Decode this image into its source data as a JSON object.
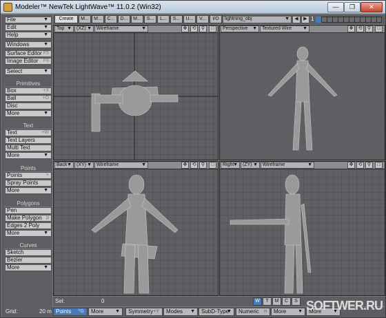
{
  "window": {
    "title": "Modeler™ NewTek LightWave™ 11.0.2 (Win32)",
    "controls": [
      "—",
      "❐",
      "✕"
    ]
  },
  "menu": {
    "file": "File",
    "edit": "Edit",
    "help": "Help",
    "windows": "Windows",
    "surface_editor": "Surface Editor",
    "surface_editor_key": "F5",
    "image_editor": "Image Editor",
    "image_editor_key": "F6",
    "select": "Select"
  },
  "groups": {
    "primitives": {
      "title": "Primitives",
      "items": [
        {
          "label": "Box",
          "key": "+X"
        },
        {
          "label": "Ball",
          "key": "+O"
        },
        {
          "label": "Disc",
          "key": ""
        },
        {
          "label": "More",
          "key": ""
        }
      ]
    },
    "text": {
      "title": "Text",
      "items": [
        {
          "label": "Text",
          "key": "+W"
        },
        {
          "label": "Text Layers",
          "key": ""
        },
        {
          "label": "Multi Text",
          "key": ""
        },
        {
          "label": "More",
          "key": ""
        }
      ]
    },
    "points": {
      "title": "Points",
      "items": [
        {
          "label": "Points",
          "key": "+"
        },
        {
          "label": "Spray Points",
          "key": ""
        },
        {
          "label": "More",
          "key": ""
        }
      ]
    },
    "polygons": {
      "title": "Polygons",
      "items": [
        {
          "label": "Pen",
          "key": ""
        },
        {
          "label": "Make Polygon",
          "key": "p"
        },
        {
          "label": "Edges 2 Poly",
          "key": ""
        },
        {
          "label": "More",
          "key": ""
        }
      ]
    },
    "curves": {
      "title": "Curves",
      "items": [
        {
          "label": "Sketch",
          "key": ""
        },
        {
          "label": "Bezier",
          "key": ""
        },
        {
          "label": "More",
          "key": ""
        }
      ]
    }
  },
  "tabs": [
    "Create",
    "M...",
    "M...",
    "C...",
    "D...",
    "M...",
    "S...",
    "L...",
    "S...",
    "U...",
    "V...",
    "I/O"
  ],
  "object_name": "lightning_obj",
  "layer_number": "1",
  "viewports": [
    {
      "view": "Top",
      "axis": "(XZ)",
      "mode": "Wireframe"
    },
    {
      "view": "Perspective",
      "axis": "",
      "mode": "Textured Wire"
    },
    {
      "view": "Back",
      "axis": "(XY)",
      "mode": "Wireframe"
    },
    {
      "view": "Right",
      "axis": "(ZY)",
      "mode": "Wireframe"
    }
  ],
  "status": {
    "sel_label": "Sel:",
    "sel_value": "0",
    "grid_label": "Grid:",
    "grid_value": "20 m",
    "wtmc": [
      "W",
      "T",
      "M",
      "C",
      "S"
    ]
  },
  "bottom": {
    "points": "Points",
    "points_key": "^G",
    "more": "More",
    "symmetry": "Symmetry",
    "symmetry_key": "+Y",
    "modes": "Modes",
    "subd": "SubD-Type",
    "numeric": "Numeric",
    "numeric_key": "n",
    "more2": "More",
    "more3": "More"
  },
  "watermark": "SOFTWER.RU",
  "colors": {
    "selected": "#4b78b6",
    "viewport_bg": "#5f6064",
    "wire": "#c8c8c8"
  }
}
